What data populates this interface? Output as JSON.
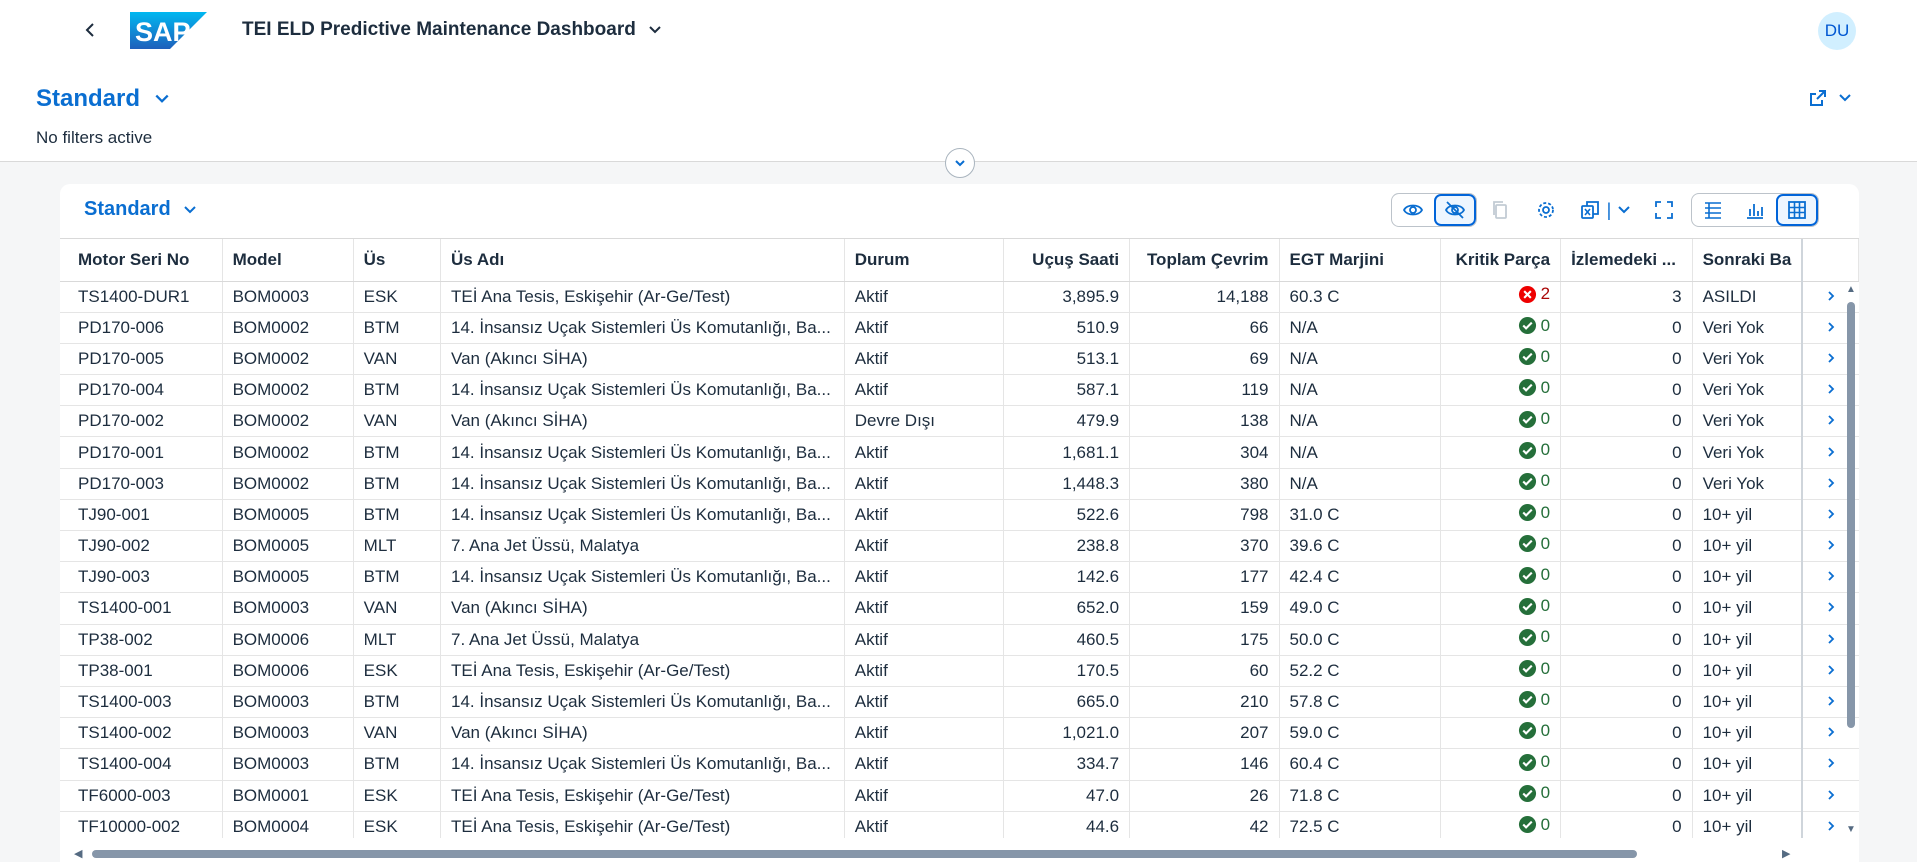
{
  "shell": {
    "logo_text": "SAP",
    "app_title": "TEI ELD Predictive Maintenance Dashboard",
    "avatar_initials": "DU"
  },
  "header": {
    "variant": "Standard",
    "filter_status": "No filters active"
  },
  "table": {
    "title": "Standard",
    "columns": [
      "Motor Seri No",
      "Model",
      "Üs",
      "Üs Adı",
      "Durum",
      "Uçuş Saati",
      "Toplam Çevrim",
      "EGT Marjini",
      "Kritik Parça",
      "İzlemedeki ...",
      "Sonraki Ba"
    ],
    "rows": [
      [
        "TS1400-DUR1",
        "BOM0003",
        "ESK",
        "TEİ Ana Tesis, Eskişehir (Ar-Ge/Test)",
        "Aktif",
        "3,895.9",
        "14,188",
        "60.3 C",
        "2",
        "3",
        "ASILDI"
      ],
      [
        "PD170-006",
        "BOM0002",
        "BTM",
        "14. İnsansız Uçak Sistemleri Üs Komutanlığı, Ba...",
        "Aktif",
        "510.9",
        "66",
        "N/A",
        "0",
        "0",
        "Veri Yok"
      ],
      [
        "PD170-005",
        "BOM0002",
        "VAN",
        "Van (Akıncı SİHA)",
        "Aktif",
        "513.1",
        "69",
        "N/A",
        "0",
        "0",
        "Veri Yok"
      ],
      [
        "PD170-004",
        "BOM0002",
        "BTM",
        "14. İnsansız Uçak Sistemleri Üs Komutanlığı, Ba...",
        "Aktif",
        "587.1",
        "119",
        "N/A",
        "0",
        "0",
        "Veri Yok"
      ],
      [
        "PD170-002",
        "BOM0002",
        "VAN",
        "Van (Akıncı SİHA)",
        "Devre Dışı",
        "479.9",
        "138",
        "N/A",
        "0",
        "0",
        "Veri Yok"
      ],
      [
        "PD170-001",
        "BOM0002",
        "BTM",
        "14. İnsansız Uçak Sistemleri Üs Komutanlığı, Ba...",
        "Aktif",
        "1,681.1",
        "304",
        "N/A",
        "0",
        "0",
        "Veri Yok"
      ],
      [
        "PD170-003",
        "BOM0002",
        "BTM",
        "14. İnsansız Uçak Sistemleri Üs Komutanlığı, Ba...",
        "Aktif",
        "1,448.3",
        "380",
        "N/A",
        "0",
        "0",
        "Veri Yok"
      ],
      [
        "TJ90-001",
        "BOM0005",
        "BTM",
        "14. İnsansız Uçak Sistemleri Üs Komutanlığı, Ba...",
        "Aktif",
        "522.6",
        "798",
        "31.0 C",
        "0",
        "0",
        "10+ yil"
      ],
      [
        "TJ90-002",
        "BOM0005",
        "MLT",
        "7. Ana Jet Üssü, Malatya",
        "Aktif",
        "238.8",
        "370",
        "39.6 C",
        "0",
        "0",
        "10+ yil"
      ],
      [
        "TJ90-003",
        "BOM0005",
        "BTM",
        "14. İnsansız Uçak Sistemleri Üs Komutanlığı, Ba...",
        "Aktif",
        "142.6",
        "177",
        "42.4 C",
        "0",
        "0",
        "10+ yil"
      ],
      [
        "TS1400-001",
        "BOM0003",
        "VAN",
        "Van (Akıncı SİHA)",
        "Aktif",
        "652.0",
        "159",
        "49.0 C",
        "0",
        "0",
        "10+ yil"
      ],
      [
        "TP38-002",
        "BOM0006",
        "MLT",
        "7. Ana Jet Üssü, Malatya",
        "Aktif",
        "460.5",
        "175",
        "50.0 C",
        "0",
        "0",
        "10+ yil"
      ],
      [
        "TP38-001",
        "BOM0006",
        "ESK",
        "TEİ Ana Tesis, Eskişehir (Ar-Ge/Test)",
        "Aktif",
        "170.5",
        "60",
        "52.2 C",
        "0",
        "0",
        "10+ yil"
      ],
      [
        "TS1400-003",
        "BOM0003",
        "BTM",
        "14. İnsansız Uçak Sistemleri Üs Komutanlığı, Ba...",
        "Aktif",
        "665.0",
        "210",
        "57.8 C",
        "0",
        "0",
        "10+ yil"
      ],
      [
        "TS1400-002",
        "BOM0003",
        "VAN",
        "Van (Akıncı SİHA)",
        "Aktif",
        "1,021.0",
        "207",
        "59.0 C",
        "0",
        "0",
        "10+ yil"
      ],
      [
        "TS1400-004",
        "BOM0003",
        "BTM",
        "14. İnsansız Uçak Sistemleri Üs Komutanlığı, Ba...",
        "Aktif",
        "334.7",
        "146",
        "60.4 C",
        "0",
        "0",
        "10+ yil"
      ],
      [
        "TF6000-003",
        "BOM0001",
        "ESK",
        "TEİ Ana Tesis, Eskişehir (Ar-Ge/Test)",
        "Aktif",
        "47.0",
        "26",
        "71.8 C",
        "0",
        "0",
        "10+ yil"
      ],
      [
        "TF10000-002",
        "BOM0004",
        "ESK",
        "TEİ Ana Tesis, Eskişehir (Ar-Ge/Test)",
        "Aktif",
        "44.6",
        "42",
        "72.5 C",
        "0",
        "0",
        "10+ yil"
      ]
    ]
  },
  "icons": {
    "critical_error": "error-circle-icon",
    "critical_ok": "success-check-icon"
  },
  "colors": {
    "brand_blue": "#0a6ed1",
    "success": "#256f3a",
    "error": "#aa0808"
  }
}
